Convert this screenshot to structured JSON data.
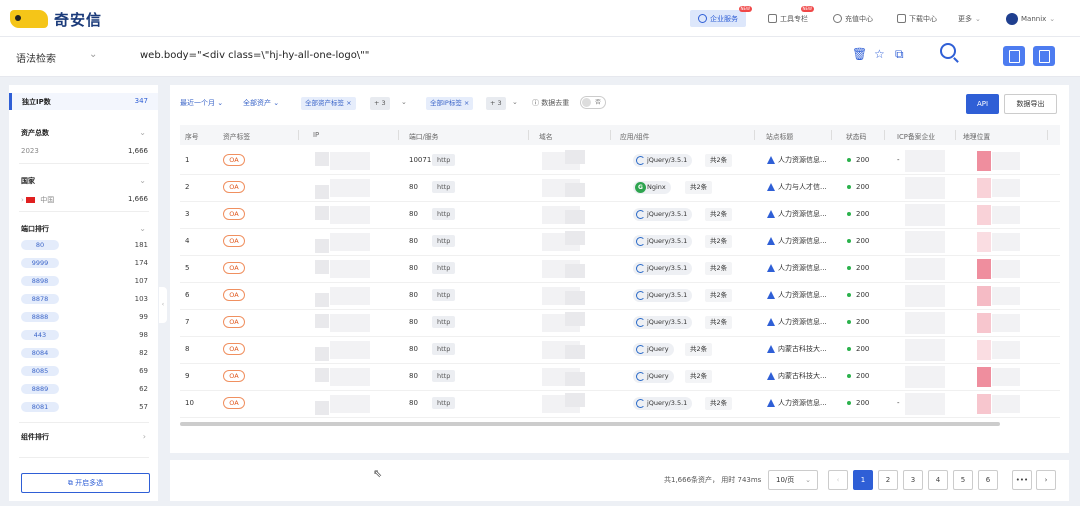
{
  "brand": {
    "name": "奇安信"
  },
  "topnav": {
    "enterprise": "企业服务",
    "tools": "工具专栏",
    "new_badge": "NEW",
    "charge": "充值中心",
    "download": "下载中心",
    "more": "更多",
    "user": "Mannix"
  },
  "search": {
    "syntax_label": "语法检索",
    "query": "web.body=\"<div class=\\\"hj-hy-all-one-logo\\\"\""
  },
  "sidebar": {
    "unique_ip_label": "独立IP数",
    "unique_ip_count": "347",
    "asset_total_label": "资产总数",
    "year": "2023",
    "year_count": "1,666",
    "country_label": "国家",
    "country_name": "中国",
    "country_count": "1,666",
    "port_rank_label": "端口排行",
    "ports": [
      {
        "port": "80",
        "count": "181"
      },
      {
        "port": "9999",
        "count": "174"
      },
      {
        "port": "8898",
        "count": "107"
      },
      {
        "port": "8878",
        "count": "103"
      },
      {
        "port": "8888",
        "count": "99"
      },
      {
        "port": "443",
        "count": "98"
      },
      {
        "port": "8084",
        "count": "82"
      },
      {
        "port": "8085",
        "count": "69"
      },
      {
        "port": "8889",
        "count": "62"
      },
      {
        "port": "8081",
        "count": "57"
      }
    ],
    "component_rank_label": "组件排行",
    "multi_select_label": "开启多选"
  },
  "filters": {
    "time": "最近一个月",
    "asset_scope": "全部资产",
    "asset_tag": "全部资产标签",
    "asset_tag_extra": "+ 3",
    "ip_tag": "全部IP标签",
    "ip_tag_extra": "+ 3",
    "dedupe_label": "数据去重",
    "dedupe_value": "否",
    "api_label": "API",
    "export_label": "数据导出"
  },
  "table": {
    "headers": [
      "序号",
      "资产标签",
      "IP",
      "端口/服务",
      "域名",
      "应用/组件",
      "站点标题",
      "状态码",
      "ICP备案企业",
      "地理位置"
    ],
    "rows": [
      {
        "no": "1",
        "tag": "OA",
        "port": "10071",
        "service": "http",
        "component": "jQuery/3.5.1",
        "comp_icon": "jquery",
        "more": "共2条",
        "title": "人力资源信息...",
        "status": "200",
        "icp": "-"
      },
      {
        "no": "2",
        "tag": "OA",
        "port": "80",
        "service": "http",
        "component": "Nginx",
        "comp_icon": "nginx",
        "more": "共2条",
        "title": "人力与人才信...",
        "status": "200",
        "icp": ""
      },
      {
        "no": "3",
        "tag": "OA",
        "port": "80",
        "service": "http",
        "component": "jQuery/3.5.1",
        "comp_icon": "jquery",
        "more": "共2条",
        "title": "人力资源信息...",
        "status": "200",
        "icp": ""
      },
      {
        "no": "4",
        "tag": "OA",
        "port": "80",
        "service": "http",
        "component": "jQuery/3.5.1",
        "comp_icon": "jquery",
        "more": "共2条",
        "title": "人力资源信息...",
        "status": "200",
        "icp": ""
      },
      {
        "no": "5",
        "tag": "OA",
        "port": "80",
        "service": "http",
        "component": "jQuery/3.5.1",
        "comp_icon": "jquery",
        "more": "共2条",
        "title": "人力资源信息...",
        "status": "200",
        "icp": ""
      },
      {
        "no": "6",
        "tag": "OA",
        "port": "80",
        "service": "http",
        "component": "jQuery/3.5.1",
        "comp_icon": "jquery",
        "more": "共2条",
        "title": "人力资源信息...",
        "status": "200",
        "icp": ""
      },
      {
        "no": "7",
        "tag": "OA",
        "port": "80",
        "service": "http",
        "component": "jQuery/3.5.1",
        "comp_icon": "jquery",
        "more": "共2条",
        "title": "人力资源信息...",
        "status": "200",
        "icp": ""
      },
      {
        "no": "8",
        "tag": "OA",
        "port": "80",
        "service": "http",
        "component": "jQuery",
        "comp_icon": "jquery",
        "more": "共2条",
        "title": "内蒙古科技大...",
        "status": "200",
        "icp": ""
      },
      {
        "no": "9",
        "tag": "OA",
        "port": "80",
        "service": "http",
        "component": "jQuery",
        "comp_icon": "jquery",
        "more": "共2条",
        "title": "内蒙古科技大...",
        "status": "200",
        "icp": ""
      },
      {
        "no": "10",
        "tag": "OA",
        "port": "80",
        "service": "http",
        "component": "jQuery/3.5.1",
        "comp_icon": "jquery",
        "more": "共2条",
        "title": "人力资源信息...",
        "status": "200",
        "icp": "-"
      }
    ]
  },
  "pagination": {
    "total": "共1,666条资产， 用时 743ms",
    "per_page": "10/页",
    "pages": [
      "1",
      "2",
      "3",
      "4",
      "5",
      "6"
    ],
    "ellipsis": "•••",
    "prev": "‹",
    "next": "›"
  },
  "colors": {
    "accent": "#2f5fd6",
    "tag_orange": "#e05a20",
    "status_green": "#2bb24c"
  }
}
